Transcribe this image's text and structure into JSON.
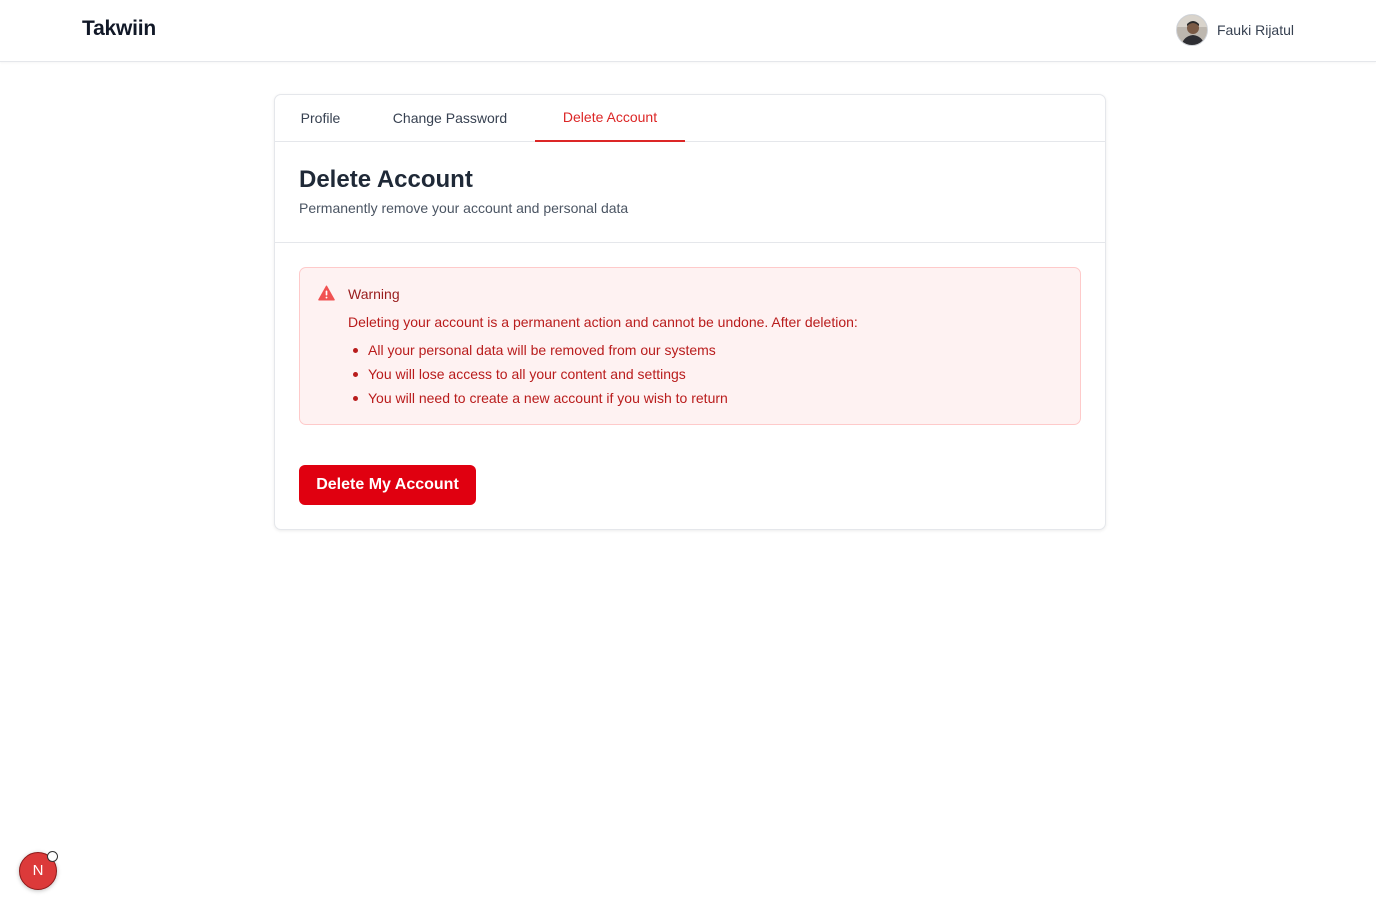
{
  "app": {
    "brand": "Takwiin"
  },
  "user": {
    "name": "Fauki Rijatul",
    "avatar_icon": "user-avatar-photo"
  },
  "tabs": [
    {
      "label": "Profile",
      "active": false
    },
    {
      "label": "Change Password",
      "active": false
    },
    {
      "label": "Delete Account",
      "active": true
    }
  ],
  "section": {
    "title": "Delete Account",
    "subtitle": "Permanently remove your account and personal data"
  },
  "warning": {
    "icon": "warning-triangle-icon",
    "title": "Warning",
    "text": "Deleting your account is a permanent action and cannot be undone. After deletion:",
    "items": [
      "All your personal data will be removed from our systems",
      "You will lose access to all your content and settings",
      "You will need to create a new account if you wish to return"
    ]
  },
  "actions": {
    "delete_label": "Delete My Account"
  },
  "devtools": {
    "letter": "N"
  },
  "colors": {
    "accent": "#dc2626",
    "danger_button": "#e00010",
    "warning_bg": "#fef2f2",
    "warning_border": "#fecaca",
    "warning_text": "#b91c1c"
  }
}
